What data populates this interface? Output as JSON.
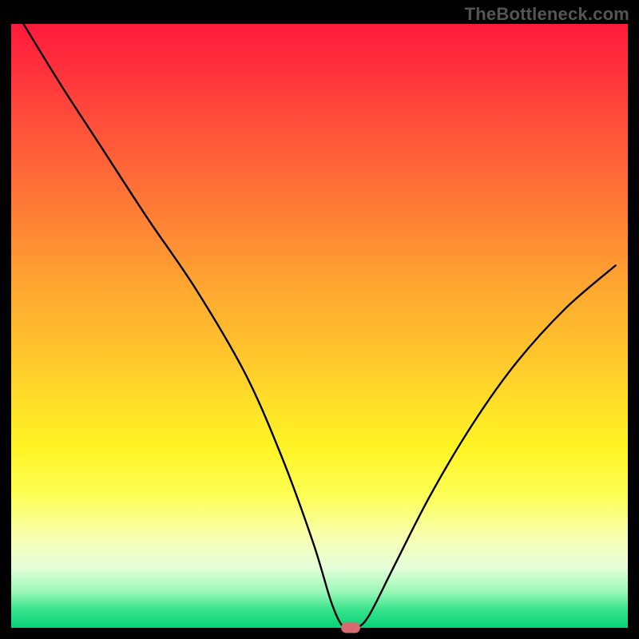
{
  "watermark": "TheBottleneck.com",
  "chart_data": {
    "type": "line",
    "title": "",
    "xlabel": "",
    "ylabel": "",
    "xlim": [
      0,
      100
    ],
    "ylim": [
      0,
      100
    ],
    "grid": false,
    "legend": false,
    "series": [
      {
        "name": "bottleneck-curve",
        "x": [
          2,
          8,
          15,
          22,
          30,
          38,
          44,
          49,
          52,
          54,
          56,
          58,
          62,
          68,
          75,
          82,
          90,
          98
        ],
        "y": [
          100,
          90,
          79,
          68,
          56,
          42,
          28,
          14,
          4,
          0,
          0,
          2,
          10,
          22,
          34,
          44,
          53,
          60
        ]
      }
    ],
    "marker": {
      "x": 55,
      "y": 0,
      "color": "#d76a6f"
    },
    "background_gradient": {
      "top": "#ff1a3c",
      "mid": "#ffe028",
      "bottom": "#08d277"
    }
  }
}
